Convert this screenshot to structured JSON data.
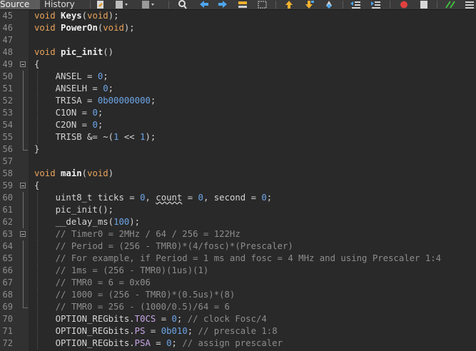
{
  "toolbar": {
    "tabs": [
      {
        "label": "Source",
        "active": true
      },
      {
        "label": "History",
        "active": false
      }
    ],
    "icons": [
      "last-edit-icon",
      "back-dropdown-icon",
      "forward-dropdown-icon",
      "find-icon",
      "find-previous-icon",
      "find-next-icon",
      "toggle-highlight-icon",
      "toggle-rectangular-selection-icon",
      "previous-bookmark-icon",
      "next-bookmark-icon",
      "toggle-bookmark-icon",
      "shift-left-icon",
      "shift-right-icon",
      "start-macro-icon",
      "stop-macro-icon",
      "comment-icon",
      "uncomment-icon"
    ]
  },
  "colors": {
    "background": "#292929",
    "gutter": "#313131",
    "keyword": "#e8a35a",
    "number": "#6da6e8",
    "comment": "#8d8d8d",
    "field": "#c8a6e6"
  },
  "lines": [
    {
      "num": "45",
      "text": "void Keys(void);"
    },
    {
      "num": "46",
      "text": "void PowerOn(void);"
    },
    {
      "num": "47",
      "text": ""
    },
    {
      "num": "48",
      "text": "void pic_init()"
    },
    {
      "num": "49",
      "text": "{"
    },
    {
      "num": "50",
      "text": "ANSEL = 0;"
    },
    {
      "num": "51",
      "text": "ANSELH = 0;"
    },
    {
      "num": "52",
      "text": "TRISA = 0b00000000;"
    },
    {
      "num": "53",
      "text": "C1ON = 0;"
    },
    {
      "num": "54",
      "text": "C2ON = 0;"
    },
    {
      "num": "55",
      "text": "TRISB &= ~(1 << 1);"
    },
    {
      "num": "56",
      "text": "}"
    },
    {
      "num": "57",
      "text": ""
    },
    {
      "num": "58",
      "text": "void main(void)"
    },
    {
      "num": "59",
      "text": "{"
    },
    {
      "num": "60",
      "text": "uint8_t ticks = 0, count = 0, second = 0;"
    },
    {
      "num": "61",
      "text": "pic_init();"
    },
    {
      "num": "62",
      "text": "__delay_ms(100);"
    },
    {
      "num": "63",
      "text": "// Timer0 = 2MHz / 64 / 256 = 122Hz"
    },
    {
      "num": "64",
      "text": "// Period = (256 - TMR0)*(4/fosc)*(Prescaler)"
    },
    {
      "num": "65",
      "text": "// For example, if Period = 1 ms and fosc = 4 MHz and using Prescaler 1:4"
    },
    {
      "num": "66",
      "text": "// 1ms = (256 - TMR0)(1us)(1)"
    },
    {
      "num": "67",
      "text": "// TMR0 = 6 = 0x06"
    },
    {
      "num": "68",
      "text": "// 1000 = (256 - TMR0)*(0.5us)*(8)"
    },
    {
      "num": "69",
      "text": "// TMR0 = 256 - (1000/0.5)/64 = 6"
    },
    {
      "num": "70",
      "text": "OPTION_REGbits.T0CS = 0; // clock Fosc/4"
    },
    {
      "num": "71",
      "text": "OPTION_REGbits.PS = 0b010; // prescale 1:8"
    },
    {
      "num": "72",
      "text": "OPTION_REGbits.PSA = 0; // assign prescaler"
    }
  ]
}
